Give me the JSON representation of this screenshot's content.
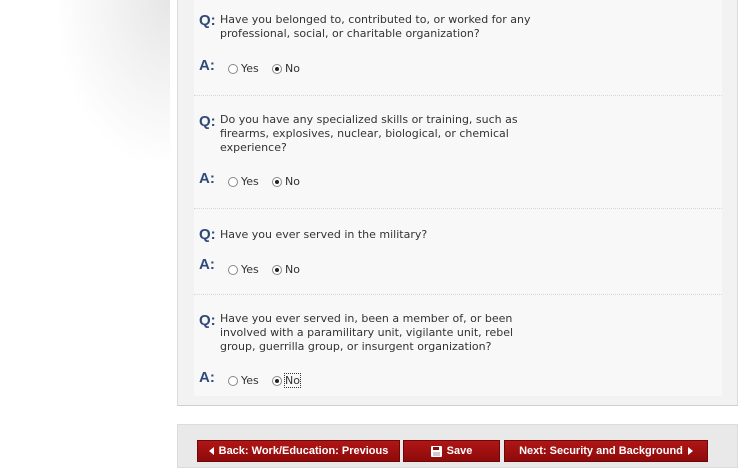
{
  "questions": [
    {
      "q_marker": "Q:",
      "a_marker": "A:",
      "lines": [
        "Have you belonged to, contributed to, or worked for any",
        "professional, social, or charitable organization?"
      ],
      "yes_label": "Yes",
      "no_label": "No",
      "selected": "No"
    },
    {
      "q_marker": "Q:",
      "a_marker": "A:",
      "lines": [
        "Do you have any specialized skills or training, such as",
        "firearms, explosives, nuclear, biological, or chemical",
        "experience?"
      ],
      "yes_label": "Yes",
      "no_label": "No",
      "selected": "No"
    },
    {
      "q_marker": "Q:",
      "a_marker": "A:",
      "lines": [
        "Have you ever served in the military?"
      ],
      "yes_label": "Yes",
      "no_label": "No",
      "selected": "No"
    },
    {
      "q_marker": "Q:",
      "a_marker": "A:",
      "lines": [
        "Have you ever served in, been a member of, or been",
        "involved with a paramilitary unit, vigilante unit, rebel",
        "group, guerrilla group, or insurgent organization?"
      ],
      "yes_label": "Yes",
      "no_label": "No",
      "selected": "No"
    }
  ],
  "buttons": {
    "back_label": "Back: Work/Education: Previous",
    "save_label": "Save",
    "next_label": "Next: Security and Background"
  },
  "colors": {
    "button_red": "#a01010",
    "marker_blue": "#2f4a78"
  }
}
